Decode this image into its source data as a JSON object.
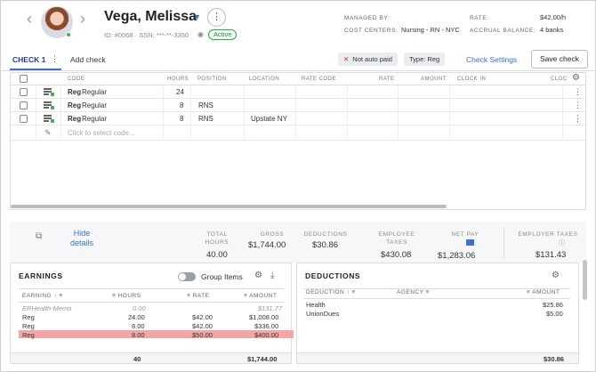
{
  "employee": {
    "name": "Vega, Melissa",
    "ids": "ID: #0068 · SSN: ***-**-3350",
    "status": "Active"
  },
  "meta": {
    "managed_by_label": "MANAGED BY:",
    "managed_by_value": "",
    "cost_centers_label": "COST CENTERS:",
    "cost_centers_value": "Nursing - RN - NYC",
    "rate_label": "RATE:",
    "rate_value": "$42.00/h",
    "accrual_label": "ACCRUAL BALANCE:",
    "accrual_value": "4 banks"
  },
  "tabs": {
    "active": "CHECK 1",
    "add": "Add check",
    "chip_not_auto_paid": "Not auto paid",
    "chip_type": "Type: Reg",
    "check_settings": "Check Settings",
    "save_check": "Save check"
  },
  "grid": {
    "headers": [
      "CODE",
      "HOURS",
      "POSITION",
      "LOCATION",
      "RATE CODE",
      "RATE",
      "AMOUNT",
      "CLOCK IN",
      "CLOC"
    ],
    "rows": [
      {
        "code": "Reg",
        "desc": "Regular",
        "hours": "24",
        "position": "",
        "location": ""
      },
      {
        "code": "Reg",
        "desc": "Regular",
        "hours": "8",
        "position": "RNS",
        "location": ""
      },
      {
        "code": "Reg",
        "desc": "Regular",
        "hours": "8",
        "position": "RNS",
        "location": "Upstate NY"
      }
    ],
    "new_row_placeholder": "Click to select code..."
  },
  "totals": {
    "hide_details": "Hide details",
    "total_hours_label": "TOTAL HOURS",
    "total_hours": "40.00",
    "gross_label": "GROSS",
    "gross": "$1,744.00",
    "deductions_label": "DEDUCTIONS",
    "deductions": "$30.86",
    "employee_taxes_label": "EMPLOYEE TAXES",
    "employee_taxes": "$430.08",
    "net_pay_label": "NET PAY",
    "net_pay": "$1,283.06",
    "employer_taxes_label": "EMPLOYER TAXES",
    "employer_taxes": "$131.43"
  },
  "earnings": {
    "title": "EARNINGS",
    "group_items": "Group Items",
    "headers": {
      "earning": "EARNING",
      "hours": "HOURS",
      "rate": "RATE",
      "amount": "AMOUNT"
    },
    "rows": [
      {
        "earning": "ERHealth-Memo",
        "hours": "0.00",
        "rate": "",
        "amount": "$131.77"
      },
      {
        "earning": "Reg",
        "hours": "24.00",
        "rate": "$42.00",
        "amount": "$1,008.00"
      },
      {
        "earning": "Reg",
        "hours": "8.00",
        "rate": "$42.00",
        "amount": "$336.00"
      },
      {
        "earning": "Reg",
        "hours": "8.00",
        "rate": "$50.00",
        "amount": "$400.00"
      }
    ],
    "total_hours": "40",
    "total_amount": "$1,744.00"
  },
  "deductions": {
    "title": "DEDUCTIONS",
    "headers": {
      "deduction": "DEDUCTION",
      "agency": "AGENCY",
      "amount": "AMOUNT"
    },
    "rows": [
      {
        "deduction": "Health",
        "amount": "$25.86"
      },
      {
        "deduction": "UnionDues",
        "amount": "$5.00"
      }
    ],
    "total": "$30.86"
  },
  "colors": {
    "accent": "#3b6fd6",
    "active_green": "#3aa34f",
    "highlight_row": "#f4a6a6"
  }
}
